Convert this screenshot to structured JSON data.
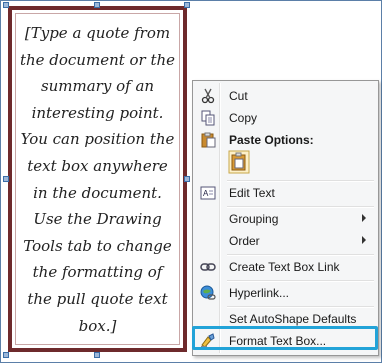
{
  "text_box": {
    "quote_text": "[Type a quote from the document or the summary of an interesting point. You can position the text box anywhere in the document. Use the Drawing Tools tab to change the formatting of the pull quote text box.]",
    "border_color": "#6e2a2c"
  },
  "context_menu": {
    "items": [
      {
        "label": "Cut",
        "icon": "scissors-icon"
      },
      {
        "label": "Copy",
        "icon": "copy-icon"
      },
      {
        "label": "Paste Options:",
        "icon": "clipboard-icon"
      },
      {
        "label": "",
        "icon": "paste-keep-format-icon"
      },
      {
        "label": "Edit Text",
        "icon": "edit-text-icon"
      },
      {
        "label": "Grouping",
        "icon": ""
      },
      {
        "label": "Order",
        "icon": ""
      },
      {
        "label": "Create Text Box Link",
        "icon": "link-chain-icon"
      },
      {
        "label": "Hyperlink...",
        "icon": "globe-link-icon"
      },
      {
        "label": "Set AutoShape Defaults",
        "icon": ""
      },
      {
        "label": "Format Text Box...",
        "icon": "format-shape-icon"
      }
    ],
    "highlight_color": "#22a3d8"
  }
}
